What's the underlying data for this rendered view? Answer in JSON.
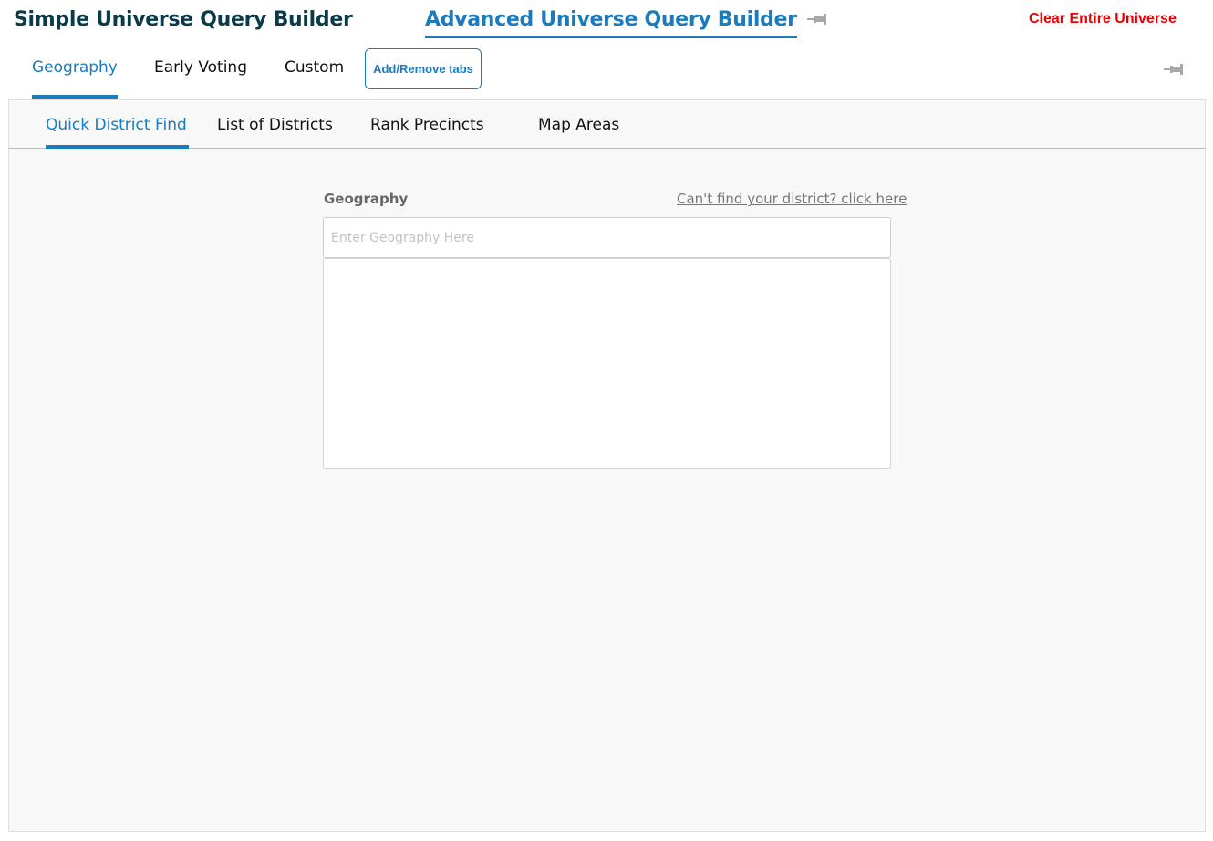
{
  "header": {
    "simple_title": "Simple Universe Query Builder",
    "advanced_title": "Advanced Universe Query Builder",
    "pin_icon": "pin-icon",
    "clear_label": "Clear Entire Universe"
  },
  "main_tabs": {
    "items": [
      {
        "label": "Geography",
        "active": true
      },
      {
        "label": "Early Voting",
        "active": false
      },
      {
        "label": "Custom",
        "active": false
      }
    ],
    "add_remove_label": "Add/Remove tabs"
  },
  "sub_tabs": {
    "items": [
      {
        "label": "Quick District Find",
        "active": true
      },
      {
        "label": "List of Districts",
        "active": false
      },
      {
        "label": "Rank Precincts",
        "active": false
      },
      {
        "label": "Map Areas",
        "active": false
      }
    ]
  },
  "geography_form": {
    "label": "Geography",
    "help_link": "Can't find your district? click here",
    "input_value": "",
    "input_placeholder": "Enter Geography Here"
  },
  "colors": {
    "accent": "#1a7bbf",
    "title_dark": "#0b3a4a",
    "danger": "#ee0000",
    "panel_bg": "#f8f8f8"
  }
}
